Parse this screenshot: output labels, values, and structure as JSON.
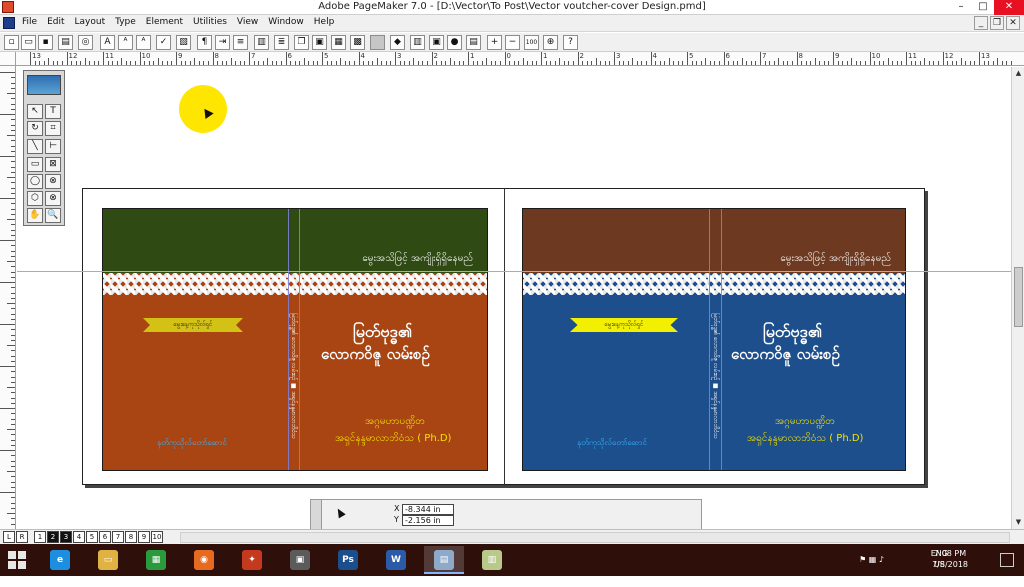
{
  "window": {
    "title": "Adobe PageMaker 7.0 - [D:\\Vector\\To Post\\Vector voutcher-cover Design.pmd]",
    "buttons": {
      "minimize": "–",
      "maximize": "□",
      "close": "✕"
    }
  },
  "menu": {
    "items": [
      "File",
      "Edit",
      "Layout",
      "Type",
      "Element",
      "Utilities",
      "View",
      "Window",
      "Help"
    ],
    "doc_buttons": {
      "minimize": "_",
      "restore": "❐",
      "close": "✕"
    }
  },
  "toolbar": {
    "icons": [
      "new-icon",
      "open-icon",
      "save-icon",
      "print-icon",
      "find-icon",
      "font-a-icon",
      "font-size-up-icon",
      "font-size-down-icon",
      "spell-check-icon",
      "edit-story-icon",
      "paragraph-icon",
      "indent-icon",
      "bullets-icon",
      "columns-icon",
      "place-icon",
      "copy-icon",
      "import-icon",
      "export-icon",
      "image-icon",
      "crop-icon",
      "color-icon",
      "globe-icon",
      "frame-icon",
      "zoom-in-icon",
      "zoom-out-icon",
      "percent-icon",
      "target-icon",
      "help-icon"
    ],
    "glyphs": {
      "font_a": "A",
      "paragraph": "¶",
      "help": "?",
      "zoom_in": "+",
      "zoom_out": "−",
      "percent": "100"
    }
  },
  "rulers": {
    "horizontal_labels": [
      "13",
      "12",
      "11",
      "10",
      "9",
      "8",
      "7",
      "6",
      "5",
      "4",
      "3",
      "2",
      "1",
      "0",
      "1",
      "2",
      "3",
      "4",
      "5",
      "6",
      "7",
      "8",
      "9",
      "10",
      "11",
      "12",
      "13"
    ],
    "vertical_labels": [
      "1",
      "2",
      "3",
      "4",
      "5",
      "6",
      "7",
      "8",
      "9",
      "10",
      "11"
    ]
  },
  "toolbox": {
    "tools": [
      "pointer-icon",
      "text-icon",
      "rotate-icon",
      "crop-icon",
      "line-icon",
      "constrained-line-icon",
      "rectangle-icon",
      "rectangle-frame-icon",
      "ellipse-icon",
      "ellipse-frame-icon",
      "polygon-icon",
      "polygon-frame-icon",
      "hand-icon",
      "zoom-icon"
    ],
    "glyphs": {
      "text": "T",
      "pointer": "↖",
      "rotate": "↻",
      "crop": "⌗",
      "line": "╲",
      "cline": "⊢",
      "rect": "▭",
      "rect_frame": "⊠",
      "ellipse": "◯",
      "ellipse_frame": "⊗",
      "polygon": "⬡",
      "polygon_frame": "⊗",
      "hand": "✋",
      "zoom": "🔍"
    }
  },
  "covers": {
    "left": {
      "top_color": "#2f4a13",
      "bottom_color": "#a84512",
      "topline": "မွေးအသိဖြင့် အကျိုးရှိရှိနေမည်",
      "ribbon": "မွေးနေ့ကုသိုလ်ရှင်",
      "ribbon_color": "#d4c116",
      "title_line1": "မြတ်ဗုဒ္ဓ၏",
      "title_line2": "လောကဝိဇူ လမ်းစဉ်",
      "author_line1": "အဂ္ဂမဟာပဏ္ဍိတ",
      "author_line2": "အရှင်နန္ဒမာလာဘိဝံသ ( Ph.D)",
      "publisher": "နတ်ကုသိုလ်တော်ဆောင်",
      "spine": "မြတ်ဗုဒ္ဓ၏ လောကဝိဇူ လမ်းစဉ်  ■  အရှင်နန္ဒမာလာဘိဝံသ"
    },
    "right": {
      "top_color": "#6d3a21",
      "bottom_color": "#1e4f8d",
      "topline": "မွေးအသိဖြင့် အကျိုးရှိရှိနေမည်",
      "ribbon": "မွေးနေ့ကုသိုလ်ရှင်",
      "ribbon_color": "#f2f000",
      "title_line1": "မြတ်ဗုဒ္ဓ၏",
      "title_line2": "လောကဝိဇူ လမ်းစဉ်",
      "author_line1": "အဂ္ဂမဟာပဏ္ဍိတ",
      "author_line2": "အရှင်နန္ဒမာလာဘိဝံသ ( Ph.D)",
      "publisher": "နတ်ကုသိုလ်တော်ဆောင်",
      "spine": "မြတ်ဗုဒ္ဓ၏ လောကဝိဇူ လမ်းစဉ်  ■  အရှင်နန္ဒမာလာဘိဝံသ"
    }
  },
  "pages": {
    "labels": [
      "L",
      "R",
      "1",
      "2",
      "3",
      "4",
      "5",
      "6",
      "7",
      "8",
      "9",
      "10"
    ],
    "active": "2"
  },
  "control_palette": {
    "x_label": "X",
    "y_label": "Y",
    "x_value": "-8.344 in",
    "y_value": "-2.156 in"
  },
  "taskbar": {
    "apps": [
      {
        "name": "internet-explorer-icon",
        "glyph": "e",
        "color": "#1e8fe0"
      },
      {
        "name": "file-explorer-icon",
        "glyph": "▭",
        "color": "#e0b244"
      },
      {
        "name": "store-icon",
        "glyph": "▦",
        "color": "#2a9a3d"
      },
      {
        "name": "firefox-icon",
        "glyph": "◉",
        "color": "#e66a1f"
      },
      {
        "name": "joystick-icon",
        "glyph": "✦",
        "color": "#c43a1f"
      },
      {
        "name": "camera-tripod-icon",
        "glyph": "▣",
        "color": "#5b5b5b"
      },
      {
        "name": "photoshop-icon",
        "glyph": "Ps",
        "color": "#1c4e8c"
      },
      {
        "name": "word-icon",
        "glyph": "W",
        "color": "#2b5aa7"
      },
      {
        "name": "pagemaker-icon",
        "glyph": "▤",
        "color": "#8fa9c9"
      },
      {
        "name": "notes-icon",
        "glyph": "▥",
        "color": "#b8c98a"
      }
    ],
    "active_index": 8,
    "language": "ENG",
    "region": "US",
    "time": "7:08 PM",
    "date": "7/8/2018"
  }
}
